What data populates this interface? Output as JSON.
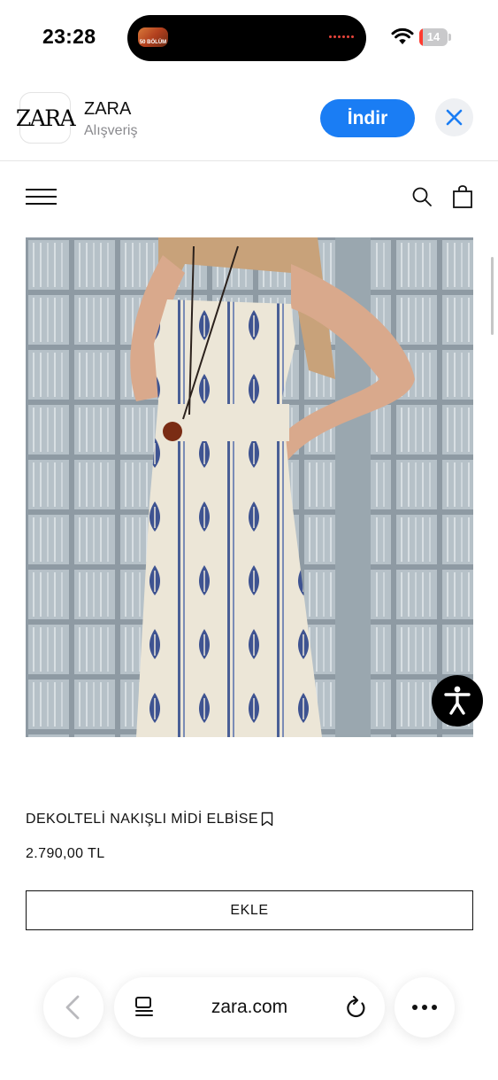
{
  "status_bar": {
    "time": "23:28",
    "live_activity_text": "50 BÖLÜM",
    "battery_level": "14",
    "battery_percent": 0.14,
    "colors": {
      "battery_low": "#ff3b30"
    }
  },
  "app_banner": {
    "icon_text": "ZARA",
    "app_name": "ZARA",
    "category": "Alışveriş",
    "install_label": "İndir",
    "close_icon": "close-icon",
    "colors": {
      "install": "#1a7df4"
    }
  },
  "site_header": {
    "menu_icon": "hamburger-menu-icon",
    "search_icon": "search-icon",
    "bag_icon": "shopping-bag-icon"
  },
  "product": {
    "title": "DEKOLTELİ NAKIŞLI MİDİ ELBİSE",
    "price": "2.790,00 TL",
    "add_label": "EKLE",
    "bookmark_icon": "bookmark-icon"
  },
  "accessibility": {
    "icon": "accessibility-icon"
  },
  "browser_toolbar": {
    "url": "zara.com",
    "back_icon": "chevron-left-icon",
    "reader_icon": "reader-mode-icon",
    "reload_icon": "reload-icon",
    "more_icon": "more-icon"
  }
}
